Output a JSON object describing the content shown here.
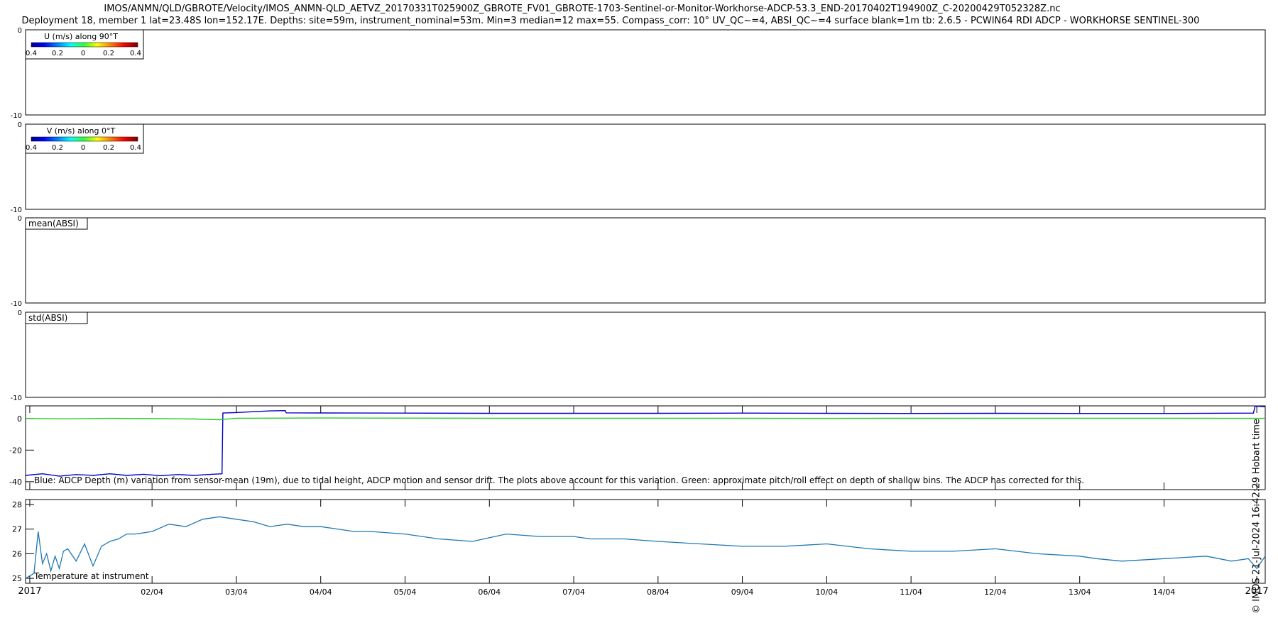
{
  "header": {
    "line1": "IMOS/ANMN/QLD/GBROTE/Velocity/IMOS_ANMN-QLD_AETVZ_20170331T025900Z_GBROTE_FV01_GBROTE-1703-Sentinel-or-Monitor-Workhorse-ADCP-53.3_END-20170402T194900Z_C-20200429T052328Z.nc",
    "line2": "Deployment 18, member 1 lat=23.48S lon=152.17E. Depths: site=59m, instrument_nominal=53m. Min=3 median=12 max=55. Compass_corr: 10° UV_QC~=4, ABSI_QC~=4 surface blank=1m tb: 2.6.5 - PCWIN64 RDI ADCP - WORKHORSE SENTINEL-300"
  },
  "credit": "© IMOS 21-Jul-2024 16:42:29 Hobart time",
  "colors": {
    "depth_line": "#0000cc",
    "pitch_line": "#22cc22",
    "temp_line": "#1f77b4"
  },
  "chart_data": [
    {
      "type": "heatmap",
      "legend": {
        "title": "U (m/s) along 90°T",
        "ticks": [
          "0.4",
          "0.2",
          "0",
          "0.2",
          "0.4"
        ]
      },
      "yticks": [
        "0",
        "-10"
      ],
      "ylim": [
        -10,
        0
      ],
      "values": []
    },
    {
      "type": "heatmap",
      "legend": {
        "title": "V (m/s) along 0°T",
        "ticks": [
          "0.4",
          "0.2",
          "0",
          "0.2",
          "0.4"
        ]
      },
      "yticks": [
        "0",
        "-10"
      ],
      "ylim": [
        -10,
        0
      ],
      "values": []
    },
    {
      "type": "heatmap",
      "label": "mean(ABSI)",
      "yticks": [
        "0",
        "-10"
      ],
      "ylim": [
        -10,
        0
      ],
      "values": []
    },
    {
      "type": "heatmap",
      "label": "std(ABSI)",
      "yticks": [
        "0",
        "-10"
      ],
      "ylim": [
        -10,
        0
      ],
      "values": []
    },
    {
      "type": "line",
      "annotation": "Blue: ADCP Depth (m) variation from sensor-mean (19m), due to tidal height, ADCP motion and sensor drift. The plots above account for this variation. Green: approximate pitch/roll effect on depth of shallow bins. The ADCP has corrected for this.",
      "yticks": [
        "0",
        "-20",
        "-40"
      ],
      "ylim": [
        -45,
        8
      ],
      "xlim": [
        0.5,
        15.2
      ],
      "series": [
        {
          "color": "blue",
          "x": [
            0.5,
            0.7,
            0.9,
            1.1,
            1.3,
            1.5,
            1.7,
            1.9,
            2.1,
            2.3,
            2.5,
            2.65,
            2.83,
            2.84,
            3.0,
            3.2,
            3.4,
            3.58,
            3.59,
            4.0,
            5.0,
            6.0,
            7.0,
            8.0,
            9.0,
            10.0,
            11.0,
            12.0,
            13.0,
            14.0,
            15.06,
            15.08,
            15.2
          ],
          "values": [
            -36,
            -35,
            -36.5,
            -35.5,
            -36,
            -35,
            -36,
            -35.3,
            -36.2,
            -35.5,
            -36,
            -35.5,
            -35,
            3.5,
            3.8,
            4.3,
            4.8,
            5,
            3.6,
            3.5,
            3.4,
            3.3,
            3.3,
            3.3,
            3.4,
            3.3,
            3.2,
            3.3,
            3.2,
            3.2,
            3.4,
            7.8,
            7.5
          ]
        },
        {
          "color": "green",
          "x": [
            0.5,
            1.0,
            1.5,
            2.0,
            2.5,
            2.8,
            3.0,
            4.0,
            6.0,
            8.0,
            10.0,
            12.0,
            14.0,
            15.2
          ],
          "values": [
            0,
            -0.2,
            0.1,
            -0.1,
            -0.3,
            -0.8,
            0.2,
            0.3,
            0.2,
            0.2,
            0.1,
            0.2,
            0.2,
            0.1
          ]
        }
      ]
    },
    {
      "type": "line",
      "label": "Temperature at instrument",
      "yticks": [
        "25",
        "26",
        "27",
        "28"
      ],
      "ylim": [
        24.8,
        28.2
      ],
      "xlim": [
        0.5,
        15.2
      ],
      "x": [
        0.5,
        0.6,
        0.65,
        0.7,
        0.75,
        0.8,
        0.85,
        0.9,
        0.95,
        1.0,
        1.1,
        1.2,
        1.3,
        1.4,
        1.5,
        1.6,
        1.7,
        1.8,
        2.0,
        2.2,
        2.4,
        2.6,
        2.8,
        3.0,
        3.2,
        3.4,
        3.6,
        3.8,
        4.0,
        4.2,
        4.4,
        4.6,
        5.0,
        5.4,
        5.8,
        6.2,
        6.6,
        7.0,
        7.2,
        7.4,
        7.6,
        8.0,
        8.5,
        9.0,
        9.5,
        10.0,
        10.5,
        11.0,
        11.5,
        12.0,
        12.5,
        13.0,
        13.2,
        13.5,
        14.0,
        14.5,
        14.8,
        15.0,
        15.1,
        15.2
      ],
      "values": [
        25.0,
        25.2,
        26.9,
        25.6,
        26.0,
        25.3,
        25.9,
        25.4,
        26.1,
        26.2,
        25.7,
        26.4,
        25.5,
        26.3,
        26.5,
        26.6,
        26.8,
        26.8,
        26.9,
        27.2,
        27.1,
        27.4,
        27.5,
        27.4,
        27.3,
        27.1,
        27.2,
        27.1,
        27.1,
        27.0,
        26.9,
        26.9,
        26.8,
        26.6,
        26.5,
        26.8,
        26.7,
        26.7,
        26.6,
        26.6,
        26.6,
        26.5,
        26.4,
        26.3,
        26.3,
        26.4,
        26.2,
        26.1,
        26.1,
        26.2,
        26.0,
        25.9,
        25.8,
        25.7,
        25.8,
        25.9,
        25.7,
        25.8,
        25.4,
        25.9
      ]
    }
  ],
  "xaxis": {
    "ticks": [
      {
        "x": 0.55,
        "label": "2017"
      },
      {
        "x": 2.0,
        "label": "02/04"
      },
      {
        "x": 3.0,
        "label": "03/04"
      },
      {
        "x": 4.0,
        "label": "04/04"
      },
      {
        "x": 5.0,
        "label": "05/04"
      },
      {
        "x": 6.0,
        "label": "06/04"
      },
      {
        "x": 7.0,
        "label": "07/04"
      },
      {
        "x": 8.0,
        "label": "08/04"
      },
      {
        "x": 9.0,
        "label": "09/04"
      },
      {
        "x": 10.0,
        "label": "10/04"
      },
      {
        "x": 11.0,
        "label": "11/04"
      },
      {
        "x": 12.0,
        "label": "12/04"
      },
      {
        "x": 13.0,
        "label": "13/04"
      },
      {
        "x": 14.0,
        "label": "14/04"
      },
      {
        "x": 15.1,
        "label": "2017"
      }
    ]
  }
}
